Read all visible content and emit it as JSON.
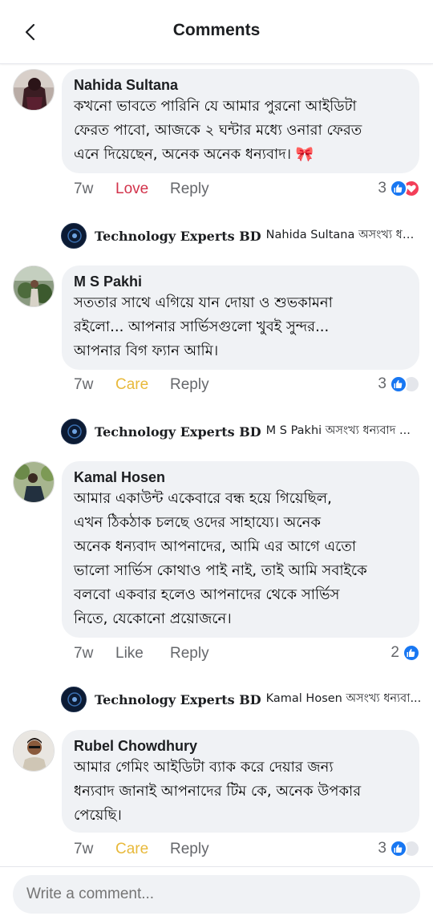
{
  "header": {
    "title": "Comments"
  },
  "comments": [
    {
      "author": "Nahida Sultana",
      "text_lines": [
        "কখনো ভাবতে পারিনি যে আমার পুরনো আইডিটা",
        "ফেরত পাবো, আজকে ২ ঘন্টার মধ্যে ওনারা ফেরত",
        "এনে দিয়েছেন, অনেক অনেক ধন্যবাদ। 🎀"
      ],
      "time": "7w",
      "reaction_label": "Love",
      "reply_label": "Reply",
      "reaction_count": "3",
      "reaction_icons": [
        "like-icon",
        "love-icon"
      ],
      "page_reply": {
        "page_name": "Technology Experts BD",
        "preview": "Nahida Sultana অসংখ্য ধন্য..."
      }
    },
    {
      "author": "M S Pakhi",
      "text_lines": [
        "সততার সাথে এগিয়ে যান দোয়া ও শুভকামনা",
        "রইলো... আপনার সার্ভিসগুলো খুবই সুন্দর...",
        "আপনার বিগ ফ্যান আমি।"
      ],
      "time": "7w",
      "reaction_label": "Care",
      "reply_label": "Reply",
      "reaction_count": "3",
      "reaction_icons": [
        "like-icon",
        "care-icon"
      ],
      "page_reply": {
        "page_name": "Technology Experts BD",
        "preview": "M S Pakhi অসংখ্য ধন্যবাদ ..."
      }
    },
    {
      "author": "Kamal Hosen",
      "text_lines": [
        "আমার একাউন্ট একেবারে বন্ধ হয়ে গিয়েছিল,",
        "এখন ঠিকঠাক চলছে ওদের সাহায্যে। অনেক",
        "অনেক ধন্যবাদ আপনাদের, আমি এর আগে এতো",
        "ভালো সার্ভিস কোথাও পাই নাই, তাই আমি সবাইকে",
        "বলবো একবার হলেও আপনাদের থেকে সার্ভিস",
        "নিতে, যেকোনো প্রয়োজনে।"
      ],
      "time": "7w",
      "reaction_label": "Like",
      "reply_label": "Reply",
      "reaction_count": "2",
      "reaction_icons": [
        "like-icon"
      ],
      "page_reply": {
        "page_name": "Technology Experts BD",
        "preview": "Kamal Hosen অসংখ্য ধন্যবা..."
      }
    },
    {
      "author": "Rubel Chowdhury",
      "text_lines": [
        "আমার গেমিং আইডিটা ব্যাক করে দেয়ার জন্য",
        "ধন্যবাদ জানাই আপনাদের টিম কে, অনেক উপকার",
        "পেয়েছি।"
      ],
      "time": "7w",
      "reaction_label": "Care",
      "reply_label": "Reply",
      "reaction_count": "3",
      "reaction_icons": [
        "like-icon",
        "care-icon"
      ]
    }
  ],
  "composer": {
    "placeholder": "Write a comment..."
  },
  "colors": {
    "like_blue": "#1877f2",
    "love_red": "#f33e58",
    "love_text": "#d2334b",
    "care_yellow": "#e8b93b",
    "bubble_bg": "#f0f2f5",
    "meta_grey": "#65676b"
  }
}
